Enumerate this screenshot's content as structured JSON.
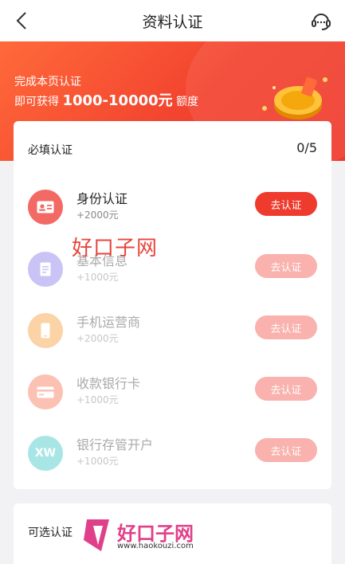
{
  "nav": {
    "title": "资料认证"
  },
  "banner": {
    "line1": "完成本页认证",
    "prefix": "即可获得",
    "amount": "1000-10000元",
    "suffix": "额度"
  },
  "required": {
    "heading": "必填认证",
    "progress": "0/5",
    "items": [
      {
        "name": "身份认证",
        "bonus": "+2000元",
        "button": "去认证",
        "icon": "id-card-icon",
        "color": "#f26a63"
      },
      {
        "name": "基本信息",
        "bonus": "+1000元",
        "button": "去认证",
        "icon": "document-icon",
        "color": "#c9c4f5"
      },
      {
        "name": "手机运营商",
        "bonus": "+2000元",
        "button": "去认证",
        "icon": "phone-icon",
        "color": "#fbd3a6"
      },
      {
        "name": "收款银行卡",
        "bonus": "+1000元",
        "button": "去认证",
        "icon": "bank-card-icon",
        "color": "#fbc2b4"
      },
      {
        "name": "银行存管开户",
        "bonus": "+1000元",
        "button": "去认证",
        "icon": "xw-bank-icon",
        "icon_text": "XW",
        "color": "#a8e6e6"
      }
    ]
  },
  "optional": {
    "heading": "可选认证"
  },
  "watermark": {
    "center_text": "好口子网",
    "brand": "好口子网",
    "url": "www.haokouzi.com"
  }
}
